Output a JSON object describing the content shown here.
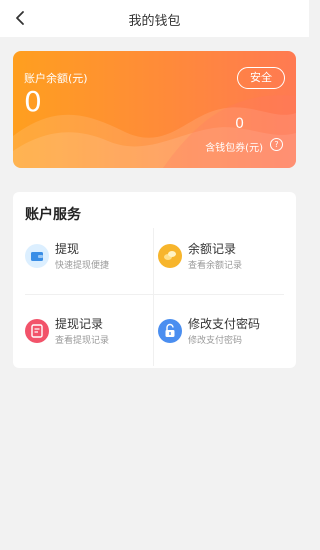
{
  "header": {
    "title": "我的钱包"
  },
  "wallet": {
    "balance_label": "账户余额(元)",
    "balance_value": "0",
    "safe_label": "安全",
    "coupon_value": "0",
    "coupon_label": "含钱包券(元)",
    "help_symbol": "?"
  },
  "services": {
    "title": "账户服务",
    "items": [
      {
        "name": "提现",
        "desc": "快速提现便捷",
        "icon": "wallet-icon",
        "color": "#dcefff"
      },
      {
        "name": "余额记录",
        "desc": "查看余额记录",
        "icon": "coins-icon",
        "color": "#f7b52c"
      },
      {
        "name": "提现记录",
        "desc": "查看提现记录",
        "icon": "record-icon",
        "color": "#f2536a"
      },
      {
        "name": "修改支付密码",
        "desc": "修改支付密码",
        "icon": "lock-icon",
        "color": "#4a8ef0"
      }
    ]
  }
}
